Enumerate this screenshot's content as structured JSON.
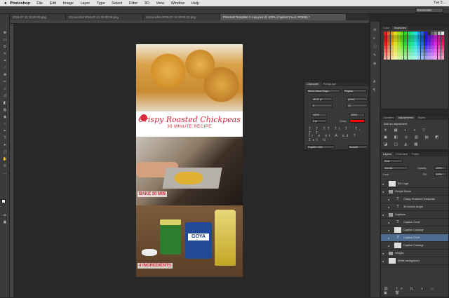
{
  "menubar": {
    "apple": "",
    "app": "Photoshop",
    "items": [
      "File",
      "Edit",
      "Image",
      "Layer",
      "Type",
      "Select",
      "Filter",
      "3D",
      "View",
      "Window",
      "Help"
    ],
    "time": "Tue 3:..."
  },
  "optionsbar": {
    "workspace": "Essentials"
  },
  "tabs": [
    {
      "label": "2016-07-11 10.03.26.png"
    },
    {
      "label": "Screenshot 2016-07-11 10.03.26.png"
    },
    {
      "label": "Screenshot 2016-07-11 10.03.43.png"
    },
    {
      "label": "Pinterest Template 2 copy.psd @ 100% (Caption 2 text, RGB/8) *"
    }
  ],
  "document": {
    "title_line1": "Crispy Roasted Chickpeas",
    "title_line2": "30 MINUTE RECIPE",
    "caption1": "BAKE 30 MIN",
    "caption2": "4 INGREDIENTS",
    "can_brand": "GOYA"
  },
  "color_panel": {
    "tabs": [
      "Color",
      "Swatches"
    ]
  },
  "character_panel": {
    "tabs": [
      "Character",
      "Paragraph"
    ],
    "font": "Bebas Neue Regu...",
    "style": "Regular",
    "size": "48.41 pt",
    "leading": "(Auto)",
    "kerning": "0",
    "tracking": "25",
    "vscale": "100%",
    "hscale": "100%",
    "baseline": "0 pt",
    "color_label": "Color:",
    "language": "English: USA",
    "aa": "Smooth",
    "text_color": "#ff0000"
  },
  "adjustments_panel": {
    "tabs": [
      "Libraries",
      "Adjustments",
      "Styles"
    ],
    "hint": "Add an adjustment"
  },
  "layers_panel": {
    "tabs": [
      "Layers",
      "Channels",
      "Paths"
    ],
    "kind": "Kind",
    "blend": "Normal",
    "opacity_label": "Opacity:",
    "opacity": "100%",
    "lock_label": "Lock:",
    "fill_label": "Fill:",
    "fill": "100%",
    "layers": [
      {
        "name": "BG Logo",
        "type": "image"
      },
      {
        "name": "Recipe Name",
        "type": "group"
      },
      {
        "name": "Crispy Roasted Chickpeas",
        "type": "text"
      },
      {
        "name": "30 minute recipe",
        "type": "text"
      },
      {
        "name": "Captions",
        "type": "group"
      },
      {
        "name": "Caption 1 text",
        "type": "text"
      },
      {
        "name": "Caption 1 backgr",
        "type": "image"
      },
      {
        "name": "Caption 2 text",
        "type": "text",
        "selected": true
      },
      {
        "name": "Caption 2 backgr",
        "type": "image"
      },
      {
        "name": "Images",
        "type": "group"
      },
      {
        "name": "White background",
        "type": "image"
      }
    ]
  }
}
